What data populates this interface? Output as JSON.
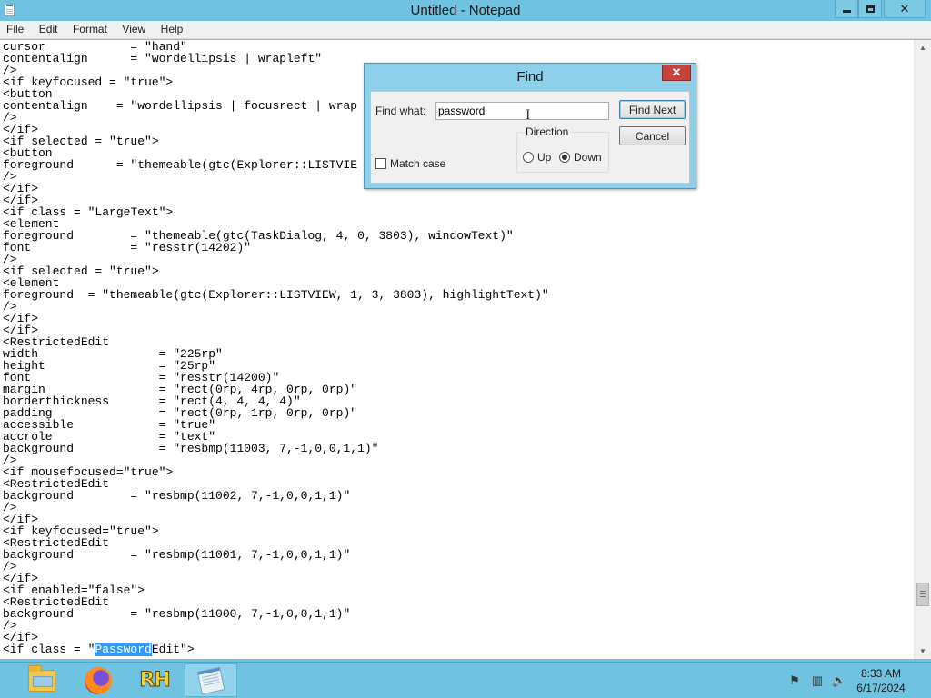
{
  "window": {
    "title": "Untitled - Notepad"
  },
  "menu": [
    "File",
    "Edit",
    "Format",
    "View",
    "Help"
  ],
  "editor": {
    "lines_before_highlight": [
      "cursor            = \"hand\"",
      "contentalign      = \"wordellipsis | wrapleft\"",
      "/>",
      "<if keyfocused = \"true\">",
      "<button",
      "contentalign    = \"wordellipsis | focusrect | wrap",
      "/>",
      "</if>",
      "<if selected = \"true\">",
      "<button",
      "foreground      = \"themeable(gtc(Explorer::LISTVIE",
      "/>",
      "</if>",
      "</if>",
      "<if class = \"LargeText\">",
      "<element",
      "foreground        = \"themeable(gtc(TaskDialog, 4, 0, 3803), windowText)\"",
      "font              = \"resstr(14202)\"",
      "/>",
      "<if selected = \"true\">",
      "<element",
      "foreground  = \"themeable(gtc(Explorer::LISTVIEW, 1, 3, 3803), highlightText)\"",
      "/>",
      "</if>",
      "</if>",
      "<RestrictedEdit",
      "width                 = \"225rp\"",
      "height                = \"25rp\"",
      "font                  = \"resstr(14200)\"",
      "margin                = \"rect(0rp, 4rp, 0rp, 0rp)\"",
      "borderthickness       = \"rect(4, 4, 4, 4)\"",
      "padding               = \"rect(0rp, 1rp, 0rp, 0rp)\"",
      "accessible            = \"true\"",
      "accrole               = \"text\"",
      "background            = \"resbmp(11003, 7,-1,0,0,1,1)\"",
      "/>",
      "<if mousefocused=\"true\">",
      "<RestrictedEdit",
      "background        = \"resbmp(11002, 7,-1,0,0,1,1)\"",
      "/>",
      "</if>",
      "<if keyfocused=\"true\">",
      "<RestrictedEdit",
      "background        = \"resbmp(11001, 7,-1,0,0,1,1)\"",
      "/>",
      "</if>",
      "<if enabled=\"false\">",
      "<RestrictedEdit",
      "background        = \"resbmp(11000, 7,-1,0,0,1,1)\"",
      "/>",
      "</if>"
    ],
    "last_line": {
      "before": "<if class = \"",
      "selected": "Password",
      "after": "Edit\">"
    }
  },
  "find_dialog": {
    "title": "Find",
    "close_label": "✕",
    "find_what_label": "Find what:",
    "find_what_value": "password",
    "find_next_label": "Find Next",
    "cancel_label": "Cancel",
    "direction_label": "Direction",
    "up_label": "Up",
    "down_label": "Down",
    "direction_selected": "Down",
    "match_case_label": "Match case",
    "match_case_checked": false
  },
  "taskbar": {
    "items": [
      "file-explorer-icon",
      "firefox-icon",
      "rh-app-icon",
      "notepad-icon"
    ],
    "rh_label": "RH",
    "time": "8:33 AM",
    "date": "6/17/2024",
    "tray_icons": [
      "action-center-flag-icon",
      "network-icon",
      "volume-muted-icon"
    ]
  },
  "colors": {
    "selection": "#3399ff",
    "chrome": "#6fc3e0",
    "close_button": "#c7423a"
  }
}
